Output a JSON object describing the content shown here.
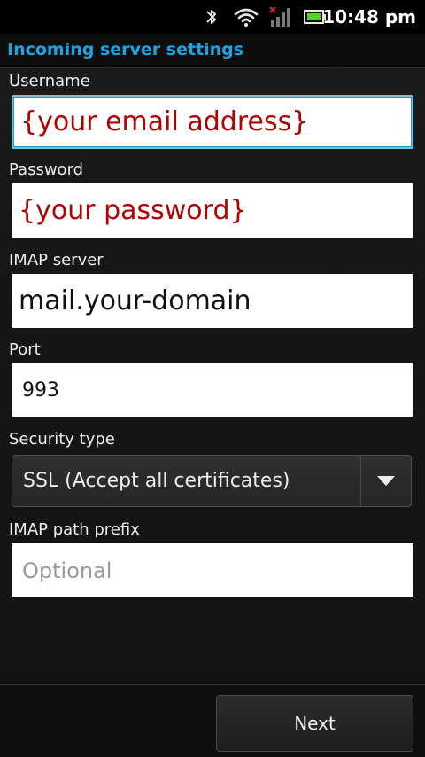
{
  "status_bar": {
    "time": "10:48 pm",
    "icons": [
      "bluetooth-icon",
      "wifi-icon",
      "signal-no-service-icon",
      "battery-icon"
    ],
    "battery_color": "#55d026"
  },
  "title": "Incoming server settings",
  "accent_color": "#1fa2e0",
  "form": {
    "username": {
      "label": "Username",
      "value": "{your email address}",
      "focused": true
    },
    "password": {
      "label": "Password",
      "value": "{your password}"
    },
    "imap_server": {
      "label": "IMAP server",
      "value": "mail.your-domain"
    },
    "port": {
      "label": "Port",
      "value": "993"
    },
    "security_type": {
      "label": "Security type",
      "selected": "SSL (Accept all certificates)"
    },
    "imap_path_prefix": {
      "label": "IMAP path prefix",
      "value": "",
      "placeholder": "Optional"
    }
  },
  "buttons": {
    "next": "Next"
  }
}
